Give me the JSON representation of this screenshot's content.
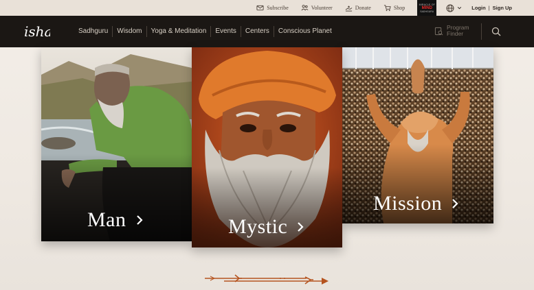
{
  "topbar": {
    "subscribe": "Subscribe",
    "volunteer": "Volunteer",
    "donate": "Donate",
    "shop": "Shop",
    "badge_top": "MIRACLE OF",
    "badge_mid": "MIND",
    "badge_bot": "SADHGURU",
    "login": "Login",
    "separator": "|",
    "signup": "Sign Up"
  },
  "nav": {
    "logo_text": "isha",
    "items": [
      "Sadhguru",
      "Wisdom",
      "Yoga & Meditation",
      "Events",
      "Centers",
      "Conscious Planet"
    ],
    "program_finder_line1": "Program",
    "program_finder_line2": "Finder"
  },
  "cards": {
    "man": {
      "label": "Man"
    },
    "mystic": {
      "label": "Mystic"
    },
    "mission": {
      "label": "Mission"
    }
  },
  "colors": {
    "nav_bg": "#1b1714",
    "topbar_bg": "#e9e1d8",
    "accent_orange": "#c8621f",
    "ornament": "#b5531e"
  }
}
